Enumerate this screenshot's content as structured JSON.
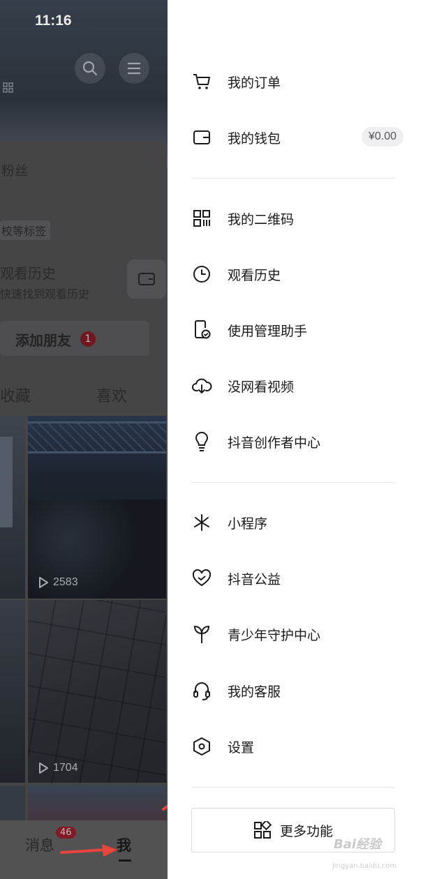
{
  "status_bar": {
    "time": "11:16"
  },
  "profile": {
    "fans_label": "粉丝",
    "tag_label": "校等标签",
    "history_title": "观看历史",
    "history_subtitle": "快速找到观看历史",
    "add_friend_label": "添加朋友",
    "add_friend_badge": "1",
    "tabs": [
      "收藏",
      "喜欢"
    ],
    "videos": [
      {
        "plays": "2583"
      },
      {
        "plays": "1704"
      }
    ]
  },
  "bottom_tabs": {
    "messages_label": "消息",
    "messages_badge": "46",
    "me_label": "我"
  },
  "drawer": {
    "items": [
      {
        "label": "我的订单",
        "icon": "cart-icon"
      },
      {
        "label": "我的钱包",
        "icon": "wallet-icon",
        "value": "¥0.00"
      },
      {
        "label": "我的二维码",
        "icon": "qr-code-icon"
      },
      {
        "label": "观看历史",
        "icon": "clock-icon"
      },
      {
        "label": "使用管理助手",
        "icon": "phone-check-icon"
      },
      {
        "label": "没网看视频",
        "icon": "cloud-download-icon"
      },
      {
        "label": "抖音创作者中心",
        "icon": "lightbulb-icon"
      },
      {
        "label": "小程序",
        "icon": "mini-program-icon"
      },
      {
        "label": "抖音公益",
        "icon": "heart-hands-icon"
      },
      {
        "label": "青少年守护中心",
        "icon": "sprout-icon"
      },
      {
        "label": "我的客服",
        "icon": "headset-icon"
      },
      {
        "label": "设置",
        "icon": "settings-icon"
      }
    ],
    "more_label": "更多功能"
  },
  "watermark": {
    "brand": "Bai经验",
    "url": "jingyan.baidu.com"
  },
  "colors": {
    "annotation_arrow": "#e8453c",
    "badge": "#e0283c"
  }
}
